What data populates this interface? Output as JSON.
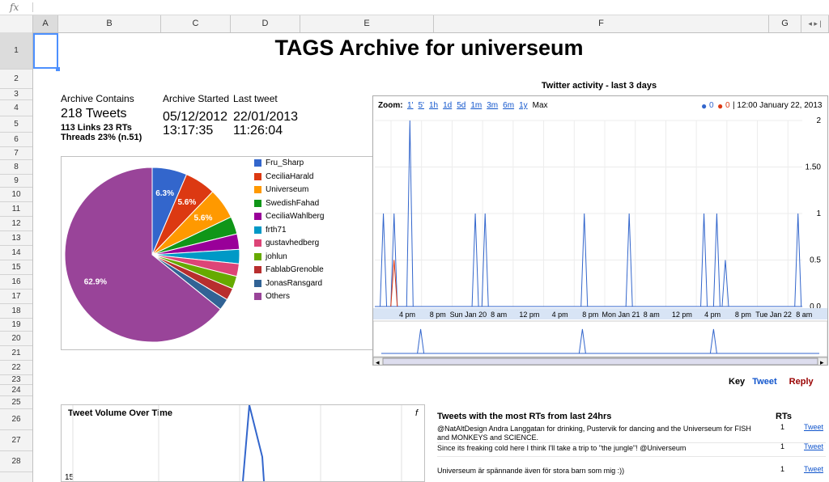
{
  "formula_bar": {
    "fx": "fx"
  },
  "columns": [
    "A",
    "B",
    "C",
    "D",
    "E",
    "F",
    "G"
  ],
  "rows": [
    "1",
    "2",
    "3",
    "4",
    "5",
    "6",
    "7",
    "8",
    "9",
    "10",
    "11",
    "12",
    "13",
    "14",
    "15",
    "16",
    "17",
    "18",
    "19",
    "20",
    "21",
    "22",
    "23",
    "24",
    "25",
    "26",
    "27",
    "28"
  ],
  "title": "TAGS Archive for universeum",
  "summary": {
    "contains_label": "Archive Contains",
    "tweets": "218 Tweets",
    "links_rts": "113 Links 23 RTs",
    "threads": "Threads 23% (n.51)",
    "started_label": "Archive Started",
    "started_date": "05/12/2012",
    "started_time": "13:17:35",
    "last_label": "Last tweet",
    "last_date": "22/01/2013",
    "last_time": "11:26:04"
  },
  "chart_data": [
    {
      "type": "pie",
      "labels": [
        "Fru_Sharp",
        "CeciliaHarald",
        "Universeum",
        "SwedishFahad",
        "CeciliaWahlberg",
        "frth71",
        "gustavhedberg",
        "johlun",
        "FablabGrenoble",
        "JonasRansgard",
        "Others"
      ],
      "values": [
        6.3,
        5.6,
        5.6,
        3.2,
        2.8,
        2.6,
        2.3,
        2.3,
        2.2,
        2.1,
        62.9
      ],
      "colors": [
        "#3366cc",
        "#dc3912",
        "#ff9900",
        "#109618",
        "#990099",
        "#0099c6",
        "#dd4477",
        "#66aa00",
        "#b82e2e",
        "#316395",
        "#994499"
      ],
      "slice_labels": [
        "6.3%",
        "5.6%",
        "5.6%",
        "",
        "",
        "",
        "",
        "",
        "",
        "",
        "62.9%"
      ],
      "legend": "right"
    },
    {
      "type": "line",
      "title": "Twitter activity - last 3 days",
      "series": [
        {
          "name": "Tweet",
          "color": "#3366cc"
        },
        {
          "name": "Reply",
          "color": "#dc3912"
        }
      ],
      "ylim": [
        0,
        2
      ],
      "yticks": [
        "2",
        "1.50",
        "1",
        "0.5",
        "0.0"
      ],
      "xticks": [
        "4 pm",
        "8 pm",
        "Sun Jan 20",
        "8 am",
        "12 pm",
        "4 pm",
        "8 pm",
        "Mon Jan 21",
        "8 am",
        "12 pm",
        "4 pm",
        "8 pm",
        "Tue Jan 22",
        "8 am"
      ],
      "spikes": [
        {
          "x": 0.02,
          "y": 1,
          "series": "Tweet"
        },
        {
          "x": 0.045,
          "y": 1,
          "series": "Tweet"
        },
        {
          "x": 0.045,
          "y": 0.5,
          "series": "Reply"
        },
        {
          "x": 0.082,
          "y": 2,
          "series": "Tweet"
        },
        {
          "x": 0.235,
          "y": 1,
          "series": "Tweet"
        },
        {
          "x": 0.258,
          "y": 1,
          "series": "Tweet"
        },
        {
          "x": 0.49,
          "y": 1,
          "series": "Tweet"
        },
        {
          "x": 0.595,
          "y": 1,
          "series": "Tweet"
        },
        {
          "x": 0.77,
          "y": 1,
          "series": "Tweet"
        },
        {
          "x": 0.8,
          "y": 1,
          "series": "Tweet"
        },
        {
          "x": 0.82,
          "y": 0.5,
          "series": "Tweet"
        },
        {
          "x": 0.99,
          "y": 1,
          "series": "Tweet"
        }
      ]
    }
  ],
  "activity": {
    "title": "Twitter activity - last 3 days",
    "zoom_label": "Zoom:",
    "zoom_options": [
      "1'",
      "5'",
      "1h",
      "1d",
      "5d",
      "1m",
      "3m",
      "6m",
      "1y"
    ],
    "zoom_max": "Max",
    "legend_blue": "0",
    "legend_red": "0",
    "legend_time": "| 12:00 January 22, 2013"
  },
  "key": {
    "label": "Key",
    "tweet": "Tweet",
    "reply": "Reply"
  },
  "volume": {
    "title": "Tweet Volume Over Time",
    "f": "f",
    "ytick": "15"
  },
  "rts": {
    "title": "Tweets with the most RTs from last 24hrs",
    "col": "RTs",
    "rows": [
      {
        "line1": "@NatAltDesign Andra Langgatan for drinking, Pustervik for dancing and the Universeum for FISH",
        "line2": "and MONKEYS and SCIENCE.",
        "count": "1",
        "link": "Tweet"
      },
      {
        "line1": "Since its freaking cold here I think I'll take a trip to \"the jungle\"! @Universeum",
        "line2": "",
        "count": "1",
        "link": "Tweet"
      },
      {
        "line1": "Universeum är spännande även för stora barn som mig :))",
        "line2": "",
        "count": "1",
        "link": "Tweet"
      }
    ]
  },
  "colors": {
    "accent": "#4d90fe",
    "link": "#1155cc",
    "reply": "#990000",
    "tweet_key": "#1155cc"
  }
}
